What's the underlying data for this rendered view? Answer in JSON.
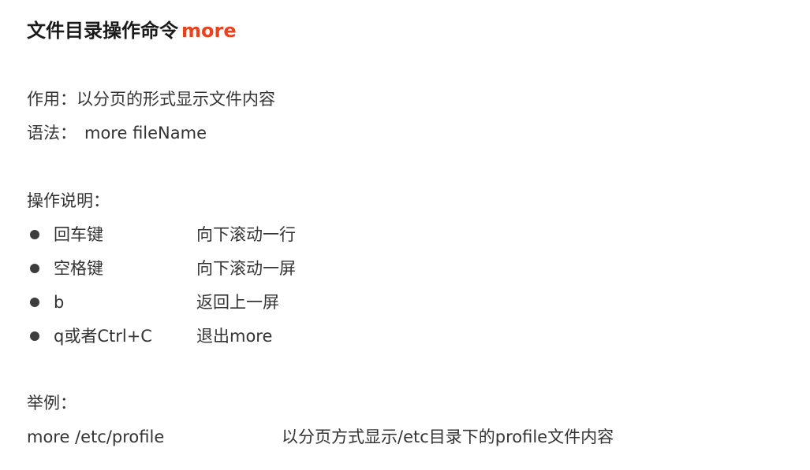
{
  "title": {
    "prefix": "文件目录操作命令",
    "command": "more",
    "accent_color": "#e8431f"
  },
  "purpose": {
    "label": "作用：",
    "text": "以分页的形式显示文件内容"
  },
  "syntax": {
    "label": "语法：",
    "text": "more fileName"
  },
  "operations": {
    "heading": "操作说明：",
    "items": [
      {
        "key": "回车键",
        "desc": "向下滚动一行"
      },
      {
        "key": "空格键",
        "desc": "向下滚动一屏"
      },
      {
        "key": "b",
        "desc": "返回上一屏"
      },
      {
        "key": "q或者Ctrl+C",
        "desc": "退出more"
      }
    ]
  },
  "example": {
    "heading": "举例：",
    "command": "more /etc/profile",
    "desc": "以分页方式显示/etc目录下的profile文件内容"
  }
}
